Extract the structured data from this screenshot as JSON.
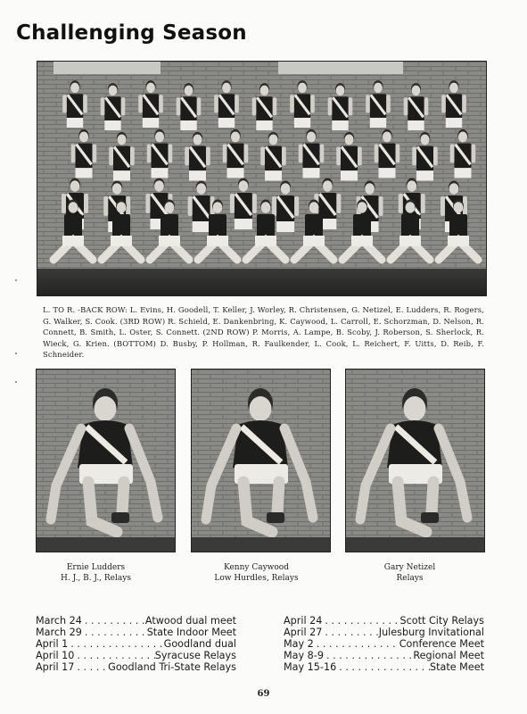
{
  "page": {
    "title": "Challenging Season",
    "page_number": "69"
  },
  "team_photo": {
    "caption": "L. TO R. -BACK ROW: L. Evins, H. Goodell, T. Keller, J. Worley, R. Christensen, G. Netizel, E. Ludders, R. Rogers, G. Walker, S. Cook. (3RD ROW) R. Schield, E. Dankenbring, K. Caywood, L. Carroll, E. Schorzman, D. Nelson, R. Connett, B. Smith, L. Oster, S. Connett. (2ND ROW) P. Morris, A. Lampe, B. Scoby, J. Roberson, S. Sherlock, R. Wieck, G. Krien. (BOTTOM) D. Busby, P. Hollman, R. Faulkender, L. Cook, L. Reichert, F. Uitts, D. Reib, F. Schneider."
  },
  "portraits": [
    {
      "name": "Ernie Ludders",
      "events": "H. J., B. J., Relays"
    },
    {
      "name": "Kenny Caywood",
      "events": "Low Hurdles, Relays"
    },
    {
      "name": "Gary Netizel",
      "events": "Relays"
    }
  ],
  "schedule_left": [
    {
      "date": "March 24",
      "event": "Atwood dual meet"
    },
    {
      "date": "March 29",
      "event": "State Indoor Meet"
    },
    {
      "date": "April 1",
      "event": "Goodland dual"
    },
    {
      "date": "April 10",
      "event": "Syracuse Relays"
    },
    {
      "date": "April 17",
      "event": "Goodland Tri-State Relays"
    }
  ],
  "schedule_right": [
    {
      "date": "April 24",
      "event": "Scott City Relays"
    },
    {
      "date": "April 27",
      "event": "Julesburg Invitational"
    },
    {
      "date": "May 2",
      "event": "Conference Meet"
    },
    {
      "date": "May 8-9",
      "event": "Regional Meet"
    },
    {
      "date": "May 15-16",
      "event": "State Meet"
    }
  ]
}
